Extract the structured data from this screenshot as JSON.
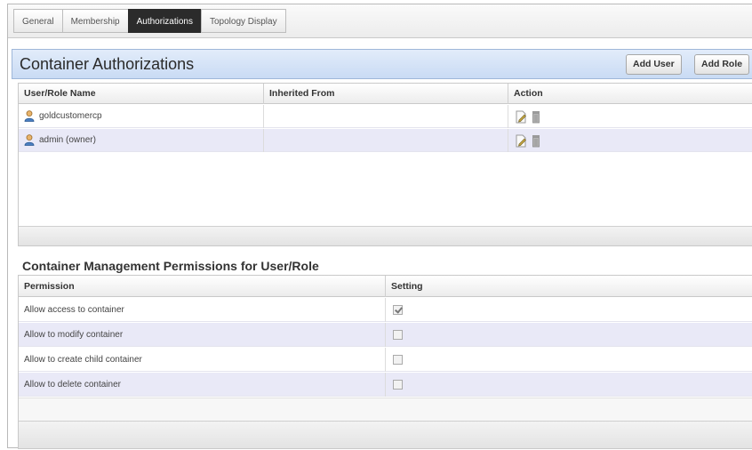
{
  "tabs": [
    {
      "label": "General",
      "active": false
    },
    {
      "label": "Membership",
      "active": false
    },
    {
      "label": "Authorizations",
      "active": true
    },
    {
      "label": "Topology Display",
      "active": false
    }
  ],
  "panel": {
    "title": "Container Authorizations",
    "add_user_label": "Add User",
    "add_role_label": "Add Role"
  },
  "auth_table": {
    "columns": [
      "User/Role Name",
      "Inherited From",
      "Action"
    ],
    "rows": [
      {
        "name": "goldcustomercp",
        "inherited": "",
        "icon": "user-icon"
      },
      {
        "name": "admin (owner)",
        "inherited": "",
        "icon": "user-icon"
      }
    ],
    "action_icons": [
      "edit-icon",
      "delete-icon"
    ]
  },
  "permissions": {
    "title": "Container Management Permissions for User/Role",
    "columns": [
      "Permission",
      "Setting"
    ],
    "rows": [
      {
        "label": "Allow access to container",
        "checked": true
      },
      {
        "label": "Allow to modify container",
        "checked": false
      },
      {
        "label": "Allow to create child container",
        "checked": false
      },
      {
        "label": "Allow to delete container",
        "checked": false
      }
    ]
  },
  "colors": {
    "header_bg": "#c9dbf4",
    "active_tab": "#2b2b2b",
    "alt_row": "#e9e9f7"
  }
}
